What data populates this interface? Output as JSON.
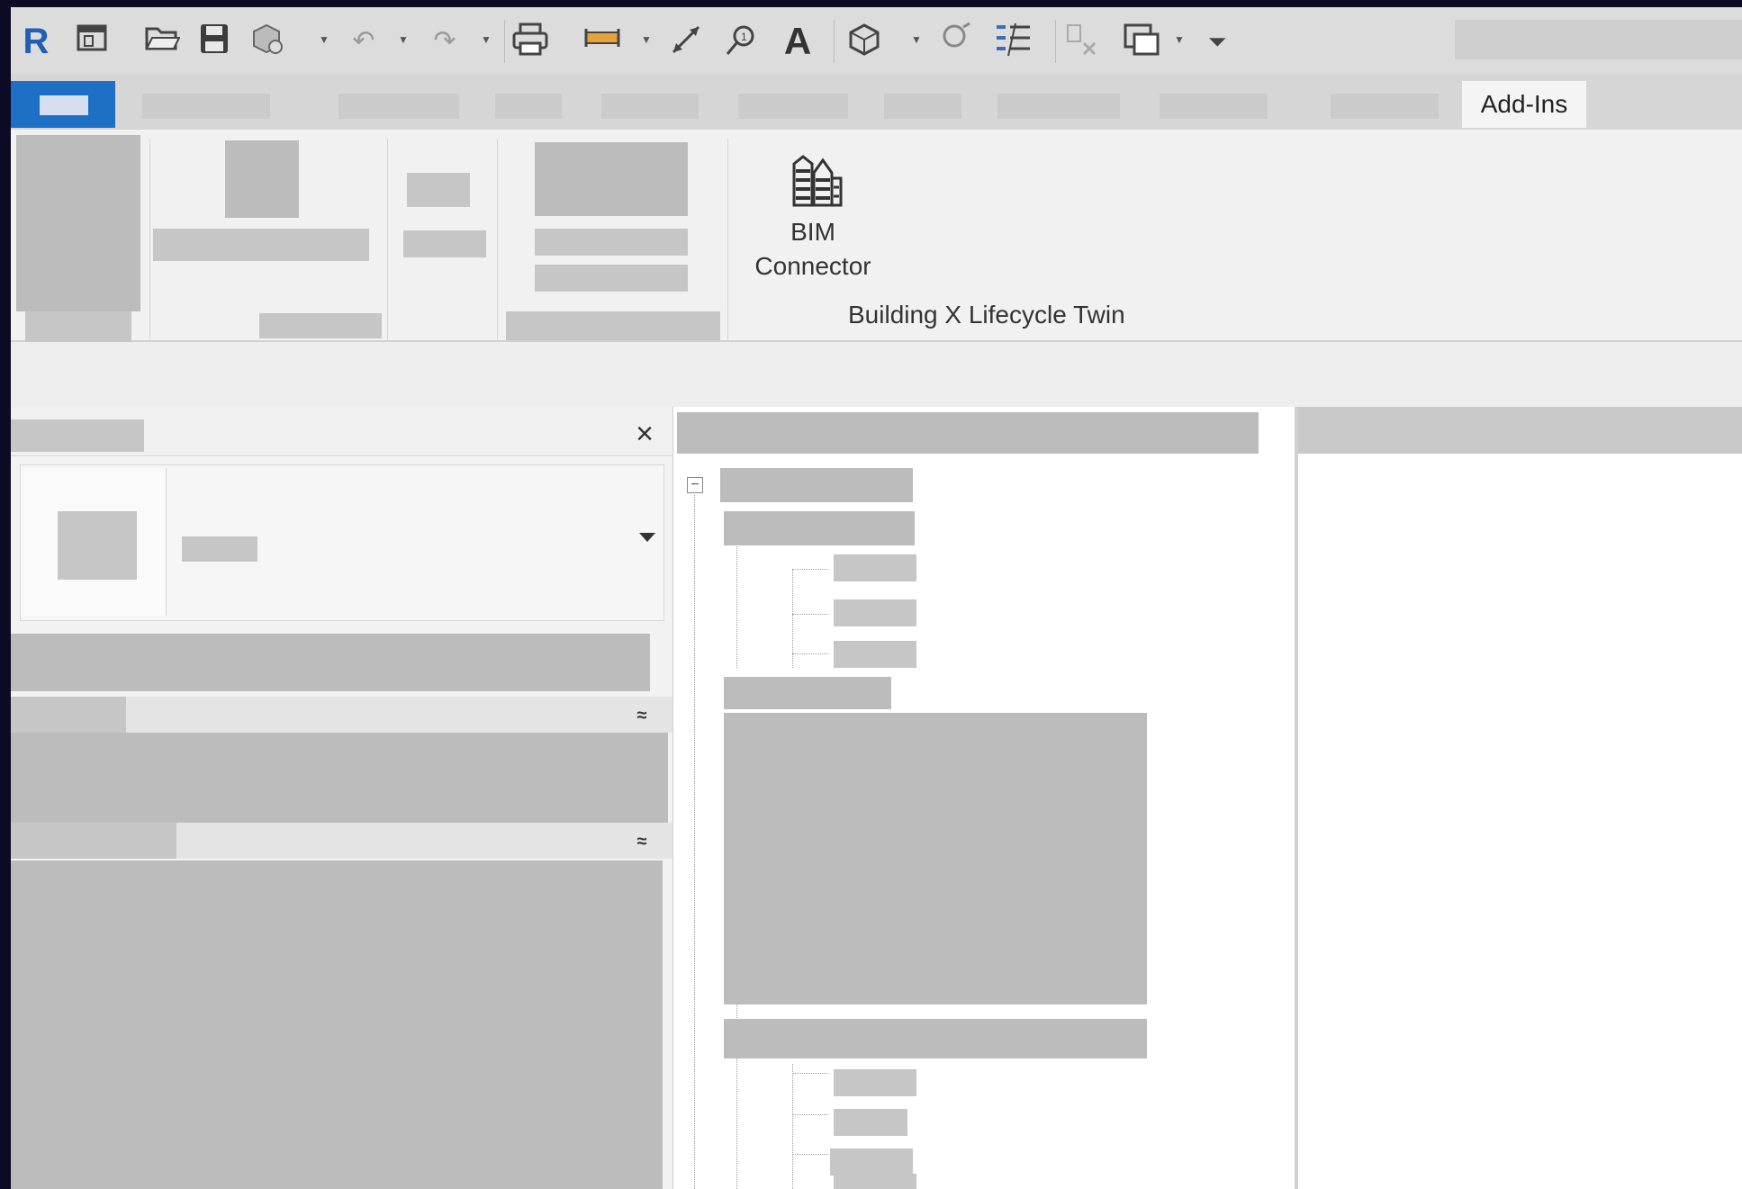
{
  "ribbon": {
    "active_tab_label": "Add-Ins",
    "bim_button": {
      "line1": "BIM",
      "line2": "Connector",
      "icon": "building-icon"
    },
    "panel_title": "Building X Lifecycle Twin"
  },
  "quick_access_icons": [
    "revit-logo-icon",
    "home-icon",
    "open-icon",
    "save-icon",
    "sync-icon",
    "undo-icon",
    "redo-icon",
    "print-icon",
    "measure-icon",
    "dimension-icon",
    "tag-icon",
    "text-icon",
    "3d-view-icon",
    "section-icon",
    "thin-lines-icon",
    "close-hidden-icon",
    "switch-windows-icon",
    "customize-icon"
  ],
  "props_panel": {
    "close_icon": "×",
    "collapse_icon": "≈"
  },
  "colors": {
    "file_tab": "#1e6fc6",
    "redacted": "#c6c6c6",
    "chrome": "#f0f0f0"
  }
}
